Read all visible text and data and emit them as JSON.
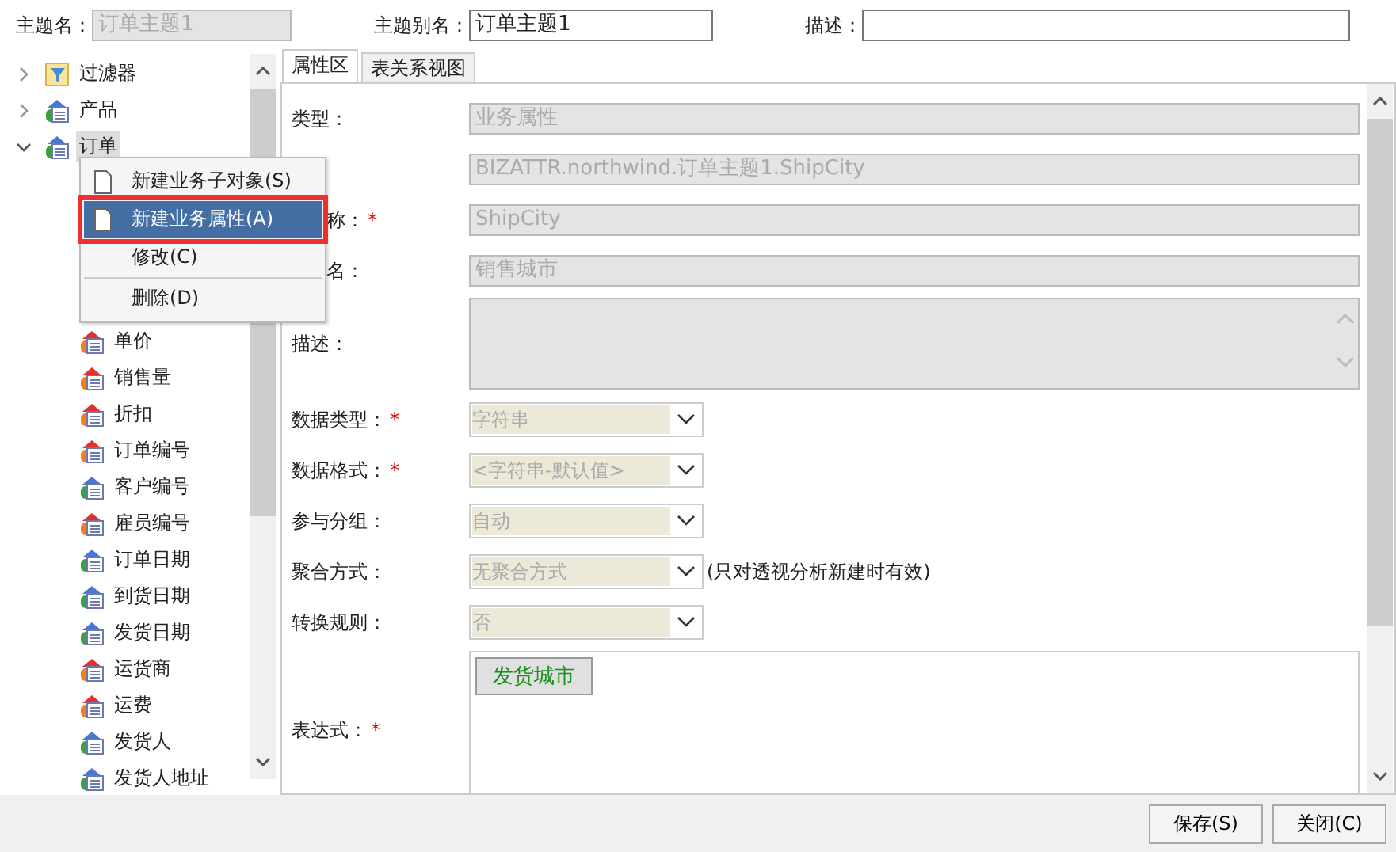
{
  "header": {
    "name": {
      "label": "主题名：",
      "value": "订单主题1",
      "disabled": true
    },
    "alias": {
      "label": "主题别名：",
      "value": "订单主题1",
      "disabled": false
    },
    "description": {
      "label": "描述：",
      "disabled": false
    }
  },
  "tree": [
    {
      "label": "过滤器",
      "kind": "filter",
      "expanded": false,
      "selected": false
    },
    {
      "label": "产品",
      "kind": "table",
      "expanded": false,
      "selected": false
    },
    {
      "label": "订单",
      "kind": "table",
      "expanded": true,
      "selected": true,
      "children": [
        {
          "label": "单价",
          "kind": "measure",
          "selected": false
        },
        {
          "label": "销售量",
          "kind": "measure",
          "selected": false
        },
        {
          "label": "折扣",
          "kind": "measure",
          "selected": false
        },
        {
          "label": "订单编号",
          "kind": "measure",
          "selected": false
        },
        {
          "label": "客户编号",
          "kind": "dimension",
          "selected": false
        },
        {
          "label": "雇员编号",
          "kind": "measure",
          "selected": false
        },
        {
          "label": "订单日期",
          "kind": "dimension",
          "selected": false
        },
        {
          "label": "到货日期",
          "kind": "dimension",
          "selected": false
        },
        {
          "label": "发货日期",
          "kind": "dimension",
          "selected": false
        },
        {
          "label": "运货商",
          "kind": "measure",
          "selected": false
        },
        {
          "label": "运费",
          "kind": "measure",
          "selected": false
        },
        {
          "label": "发货人",
          "kind": "dimension",
          "selected": false
        },
        {
          "label": "发货人地址",
          "kind": "dimension",
          "selected": false
        }
      ]
    }
  ],
  "tabs": [
    {
      "label": "属性区",
      "selected": true
    },
    {
      "label": "表关系视图",
      "selected": false
    }
  ],
  "form": [
    {
      "kind": "text",
      "label": "类型：",
      "value": "业务属性"
    },
    {
      "kind": "text",
      "value": "BIZATTR.northwind.订单主题1.ShipCity"
    },
    {
      "kind": "text",
      "label": "称：",
      "required_mark": "*",
      "value": "ShipCity"
    },
    {
      "kind": "text",
      "label": "名：",
      "value": "销售城市"
    },
    {
      "kind": "textarea",
      "label": "描述："
    },
    {
      "kind": "select",
      "label": "数据类型：",
      "required_mark": "*",
      "value": "字符串"
    },
    {
      "kind": "select",
      "label": "数据格式：",
      "required_mark": "*",
      "value": "<字符串-默认值>"
    },
    {
      "kind": "select",
      "label": "参与分组：",
      "value": "自动"
    },
    {
      "kind": "select",
      "label": "聚合方式：",
      "value": "无聚合方式",
      "note": "(只对透视分析新建时有效)"
    },
    {
      "kind": "select",
      "label": "转换规则：",
      "value": "否"
    },
    {
      "kind": "expression",
      "label": "表达式：",
      "required_mark": "*",
      "token": "发货城市"
    }
  ],
  "context_menu": [
    {
      "label": "新建业务子对象(S)",
      "kind": "document",
      "selected": false,
      "separator_before": false
    },
    {
      "label": "新建业务属性(A)",
      "kind": "document",
      "selected": true,
      "separator_before": false
    },
    {
      "label": "修改(C)",
      "selected": false,
      "separator_before": false
    },
    {
      "label": "删除(D)",
      "selected": false,
      "separator_before": true
    }
  ],
  "buttons": [
    "保存(S)",
    "关闭(C)"
  ]
}
